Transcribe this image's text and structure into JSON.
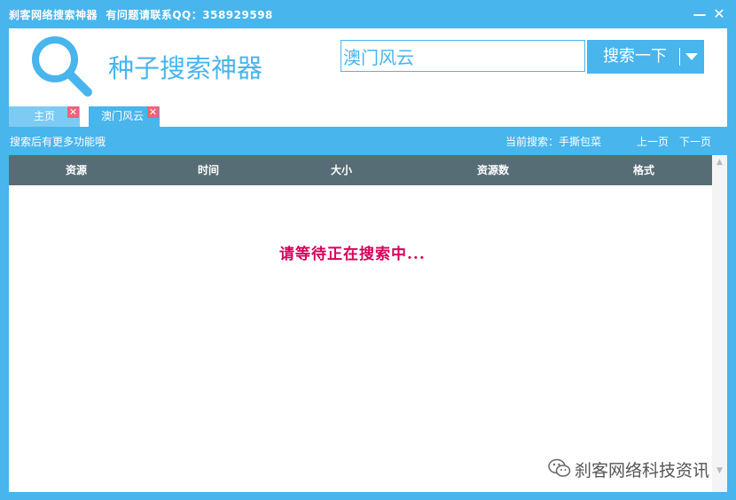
{
  "window": {
    "title": "刹客网络搜索神器  有问题请联系QQ：358929598",
    "minimize_label": "—",
    "close_label": "✕"
  },
  "header": {
    "logo_icon": "search-icon",
    "app_name": "种子搜索神器",
    "search_value": "澳门风云",
    "search_button_label": "搜索一下"
  },
  "tabs": [
    {
      "label": "主页",
      "active": false,
      "close_label": "✕"
    },
    {
      "label": "澳门风云",
      "active": true,
      "close_label": "✕"
    }
  ],
  "info_bar": {
    "hint": "搜索后有更多功能哦",
    "current_search": "当前搜索：手撕包菜",
    "prev_page": "上一页",
    "next_page": "下一页"
  },
  "table": {
    "columns": [
      "资源",
      "时间",
      "大小",
      "资源数",
      "格式"
    ]
  },
  "status_message": "请等待正在搜索中...",
  "watermark": {
    "icon": "wechat-icon",
    "text": "刹客网络科技资讯"
  },
  "colors": {
    "accent": "#48b5ec",
    "tab_inactive": "#7dcbf4",
    "table_header": "#576d75",
    "status": "#d7005a",
    "tab_close": "#f2617a"
  }
}
